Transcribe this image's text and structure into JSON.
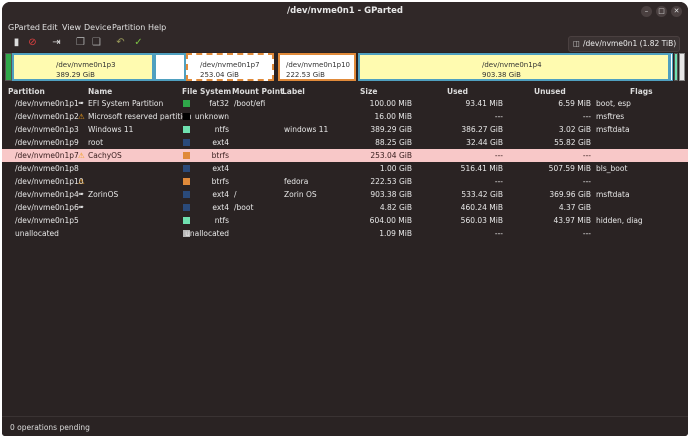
{
  "window": {
    "title": "/dev/nvme0n1 - GParted"
  },
  "menu": [
    "GParted",
    "Edit",
    "View",
    "Device",
    "Partition",
    "Help"
  ],
  "toolbar": {
    "icons": [
      "new-icon",
      "delete-icon",
      "resize-move-icon",
      "copy-icon",
      "paste-icon",
      "undo-icon",
      "apply-icon"
    ],
    "device": "/dev/nvme0n1 (1.82 TiB)"
  },
  "diskmap": [
    {
      "name": "/dev/nvme0n1p3",
      "size": "389.29 GiB"
    },
    {
      "name": "/dev/nvme0n1p7",
      "size": "253.04 GiB"
    },
    {
      "name": "/dev/nvme0n1p10",
      "size": "222.53 GiB"
    },
    {
      "name": "/dev/nvme0n1p4",
      "size": "903.38 GiB"
    }
  ],
  "columns": [
    "Partition",
    "Name",
    "File System",
    "Mount Point",
    "Label",
    "Size",
    "Used",
    "Unused",
    "Flags"
  ],
  "rows": [
    {
      "partition": "/dev/nvme0n1p1",
      "marker": "key",
      "name": "EFI System Partition",
      "fs": "fat32",
      "fscolor": "#2fa84a",
      "mount": "/boot/efi",
      "label": "",
      "size": "100.00 MiB",
      "used": "93.41 MiB",
      "unused": "6.59 MiB",
      "flags": "boot, esp"
    },
    {
      "partition": "/dev/nvme0n1p2",
      "marker": "warn",
      "name": "Microsoft reserved partition",
      "fs": "unknown",
      "fscolor": "#000000",
      "mount": "",
      "label": "",
      "size": "16.00 MiB",
      "used": "---",
      "unused": "---",
      "flags": "msftres"
    },
    {
      "partition": "/dev/nvme0n1p3",
      "marker": "",
      "name": "Windows 11",
      "fs": "ntfs",
      "fscolor": "#6fe0b0",
      "mount": "",
      "label": "windows 11",
      "size": "389.29 GiB",
      "used": "386.27 GiB",
      "unused": "3.02 GiB",
      "flags": "msftdata"
    },
    {
      "partition": "/dev/nvme0n1p9",
      "marker": "",
      "name": "root",
      "fs": "ext4",
      "fscolor": "#2a4a7a",
      "mount": "",
      "label": "",
      "size": "88.25 GiB",
      "used": "32.44 GiB",
      "unused": "55.82 GiB",
      "flags": ""
    },
    {
      "partition": "/dev/nvme0n1p7",
      "marker": "warn",
      "name": "CachyOS",
      "fs": "btrfs",
      "fscolor": "#e08a3a",
      "mount": "",
      "label": "",
      "size": "253.04 GiB",
      "used": "---",
      "unused": "---",
      "flags": "",
      "selected": true
    },
    {
      "partition": "/dev/nvme0n1p8",
      "marker": "",
      "name": "",
      "fs": "ext4",
      "fscolor": "#2a4a7a",
      "mount": "",
      "label": "",
      "size": "1.00 GiB",
      "used": "516.41 MiB",
      "unused": "507.59 MiB",
      "flags": "bls_boot"
    },
    {
      "partition": "/dev/nvme0n1p10",
      "marker": "warn",
      "name": "",
      "fs": "btrfs",
      "fscolor": "#e08a3a",
      "mount": "",
      "label": "fedora",
      "size": "222.53 GiB",
      "used": "---",
      "unused": "---",
      "flags": ""
    },
    {
      "partition": "/dev/nvme0n1p4",
      "marker": "key",
      "name": "ZorinOS",
      "fs": "ext4",
      "fscolor": "#2a4a7a",
      "mount": "/",
      "label": "Zorin OS",
      "size": "903.38 GiB",
      "used": "533.42 GiB",
      "unused": "369.96 GiB",
      "flags": "msftdata"
    },
    {
      "partition": "/dev/nvme0n1p6",
      "marker": "key",
      "name": "",
      "fs": "ext4",
      "fscolor": "#2a4a7a",
      "mount": "/boot",
      "label": "",
      "size": "4.82 GiB",
      "used": "460.24 MiB",
      "unused": "4.37 GiB",
      "flags": ""
    },
    {
      "partition": "/dev/nvme0n1p5",
      "marker": "",
      "name": "",
      "fs": "ntfs",
      "fscolor": "#6fe0b0",
      "mount": "",
      "label": "",
      "size": "604.00 MiB",
      "used": "560.03 MiB",
      "unused": "43.97 MiB",
      "flags": "hidden, diag"
    },
    {
      "partition": "unallocated",
      "marker": "",
      "name": "",
      "fs": "unallocated",
      "fscolor": "#b8b8b8",
      "mount": "",
      "label": "",
      "size": "1.09 MiB",
      "used": "---",
      "unused": "---",
      "flags": ""
    }
  ],
  "status": "0 operations pending"
}
